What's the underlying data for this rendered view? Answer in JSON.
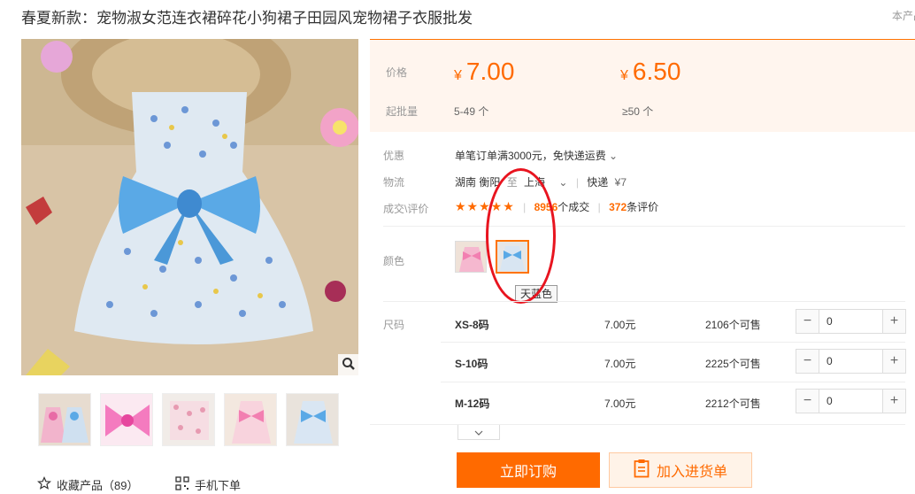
{
  "product": {
    "title": "春夏新款：宠物淑女范连衣裙碎花小狗裙子田园风宠物裙子衣服批发",
    "corner_note": "本产品"
  },
  "price_panel": {
    "price_label": "价格",
    "currency": "¥",
    "tiers": [
      {
        "price": "7.00",
        "batch": "5-49 个"
      },
      {
        "price": "6.50",
        "batch": "≥50 个"
      }
    ],
    "batch_label": "起批量"
  },
  "info": {
    "promo_label": "优惠",
    "promo_text": "单笔订单满3000元，免快递运费",
    "logistics_label": "物流",
    "logistics_from": "湖南 衡阳",
    "logistics_to_word": "至",
    "logistics_dest": "上海",
    "shipping_method": "快递",
    "shipping_fee": "¥7",
    "deals_label": "成交\\评价",
    "deals_count": "8956",
    "deals_suffix": "个成交",
    "review_count": "372",
    "review_suffix": "条评价"
  },
  "color": {
    "label": "颜色",
    "tooltip": "天蓝色",
    "options": [
      "粉色",
      "天蓝色"
    ],
    "selected": "天蓝色"
  },
  "sizes": {
    "label": "尺码",
    "rows": [
      {
        "name": "XS-8码",
        "price": "7.00元",
        "stock": "2106个可售",
        "qty": "0"
      },
      {
        "name": "S-10码",
        "price": "7.00元",
        "stock": "2225个可售",
        "qty": "0"
      },
      {
        "name": "M-12码",
        "price": "7.00元",
        "stock": "2212个可售",
        "qty": "0"
      }
    ]
  },
  "actions": {
    "buy_now": "立即订购",
    "add_to_cart": "加入进货单"
  },
  "footer": {
    "favorite_text": "收藏产品（89）",
    "mobile_order": "手机下单"
  },
  "colors": {
    "accent": "#ff6a00",
    "annotation": "#e8141f"
  }
}
